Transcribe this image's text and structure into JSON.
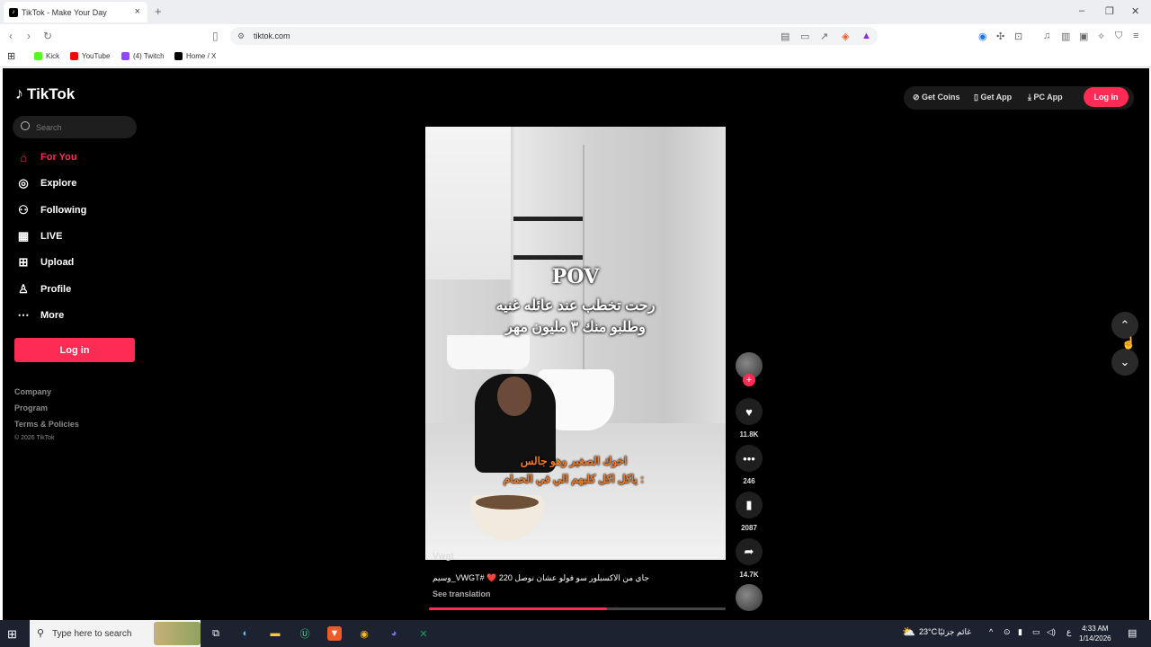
{
  "browser": {
    "tab_title": "TikTok - Make Your Day",
    "tab_close": "×",
    "new_tab": "+",
    "url": "tiktok.com",
    "bookmarks": [
      {
        "label": "Kick",
        "color": "#53fc18"
      },
      {
        "label": "YouTube",
        "color": "#ff0000"
      },
      {
        "label": "(4) Twitch",
        "color": "#9146ff"
      },
      {
        "label": "Home / X",
        "color": "#000000"
      }
    ]
  },
  "sidebar": {
    "logo": "TikTok",
    "search_placeholder": "Search",
    "nav": [
      {
        "label": "For You",
        "icon": "home-icon",
        "active": true
      },
      {
        "label": "Explore",
        "icon": "compass-icon"
      },
      {
        "label": "Following",
        "icon": "following-icon"
      },
      {
        "label": "LIVE",
        "icon": "live-icon"
      },
      {
        "label": "Upload",
        "icon": "upload-icon"
      },
      {
        "label": "Profile",
        "icon": "profile-icon"
      },
      {
        "label": "More",
        "icon": "more-icon"
      }
    ],
    "login": "Log in",
    "footer": [
      "Company",
      "Program",
      "Terms & Policies"
    ],
    "copyright": "© 2026 TikTok"
  },
  "topbar": {
    "get_coins": "Get Coins",
    "get_app": "Get App",
    "pc_app": "PC App",
    "login": "Log in"
  },
  "video": {
    "caption_title": "POV",
    "caption_line1": "رحت تخطب عند عائله غنيه",
    "caption_line2": "وطلبو منك ٣ مليون مهر",
    "caption_bottom1": "اخوك الصغير وهو جالس",
    "caption_bottom2": "ياكل اكل كلبهم الي في الحمام :",
    "author": "Vwgt",
    "description": "وسيم_VWGT# ❤️ جاي من الاكسبلور سو فولو عشان نوصل 220",
    "see_translation": "See translation",
    "progress": 0.6,
    "accent": "#fe2c55"
  },
  "actions": {
    "likes": "11.8K",
    "comments": "246",
    "saves": "2087",
    "shares": "14.7K"
  },
  "taskbar": {
    "search_placeholder": "Type here to search",
    "weather": "23°C",
    "weather_text": "غائم جزئيًا",
    "lang": "ع",
    "time": "4:33 AM",
    "date": "1/14/2026"
  }
}
